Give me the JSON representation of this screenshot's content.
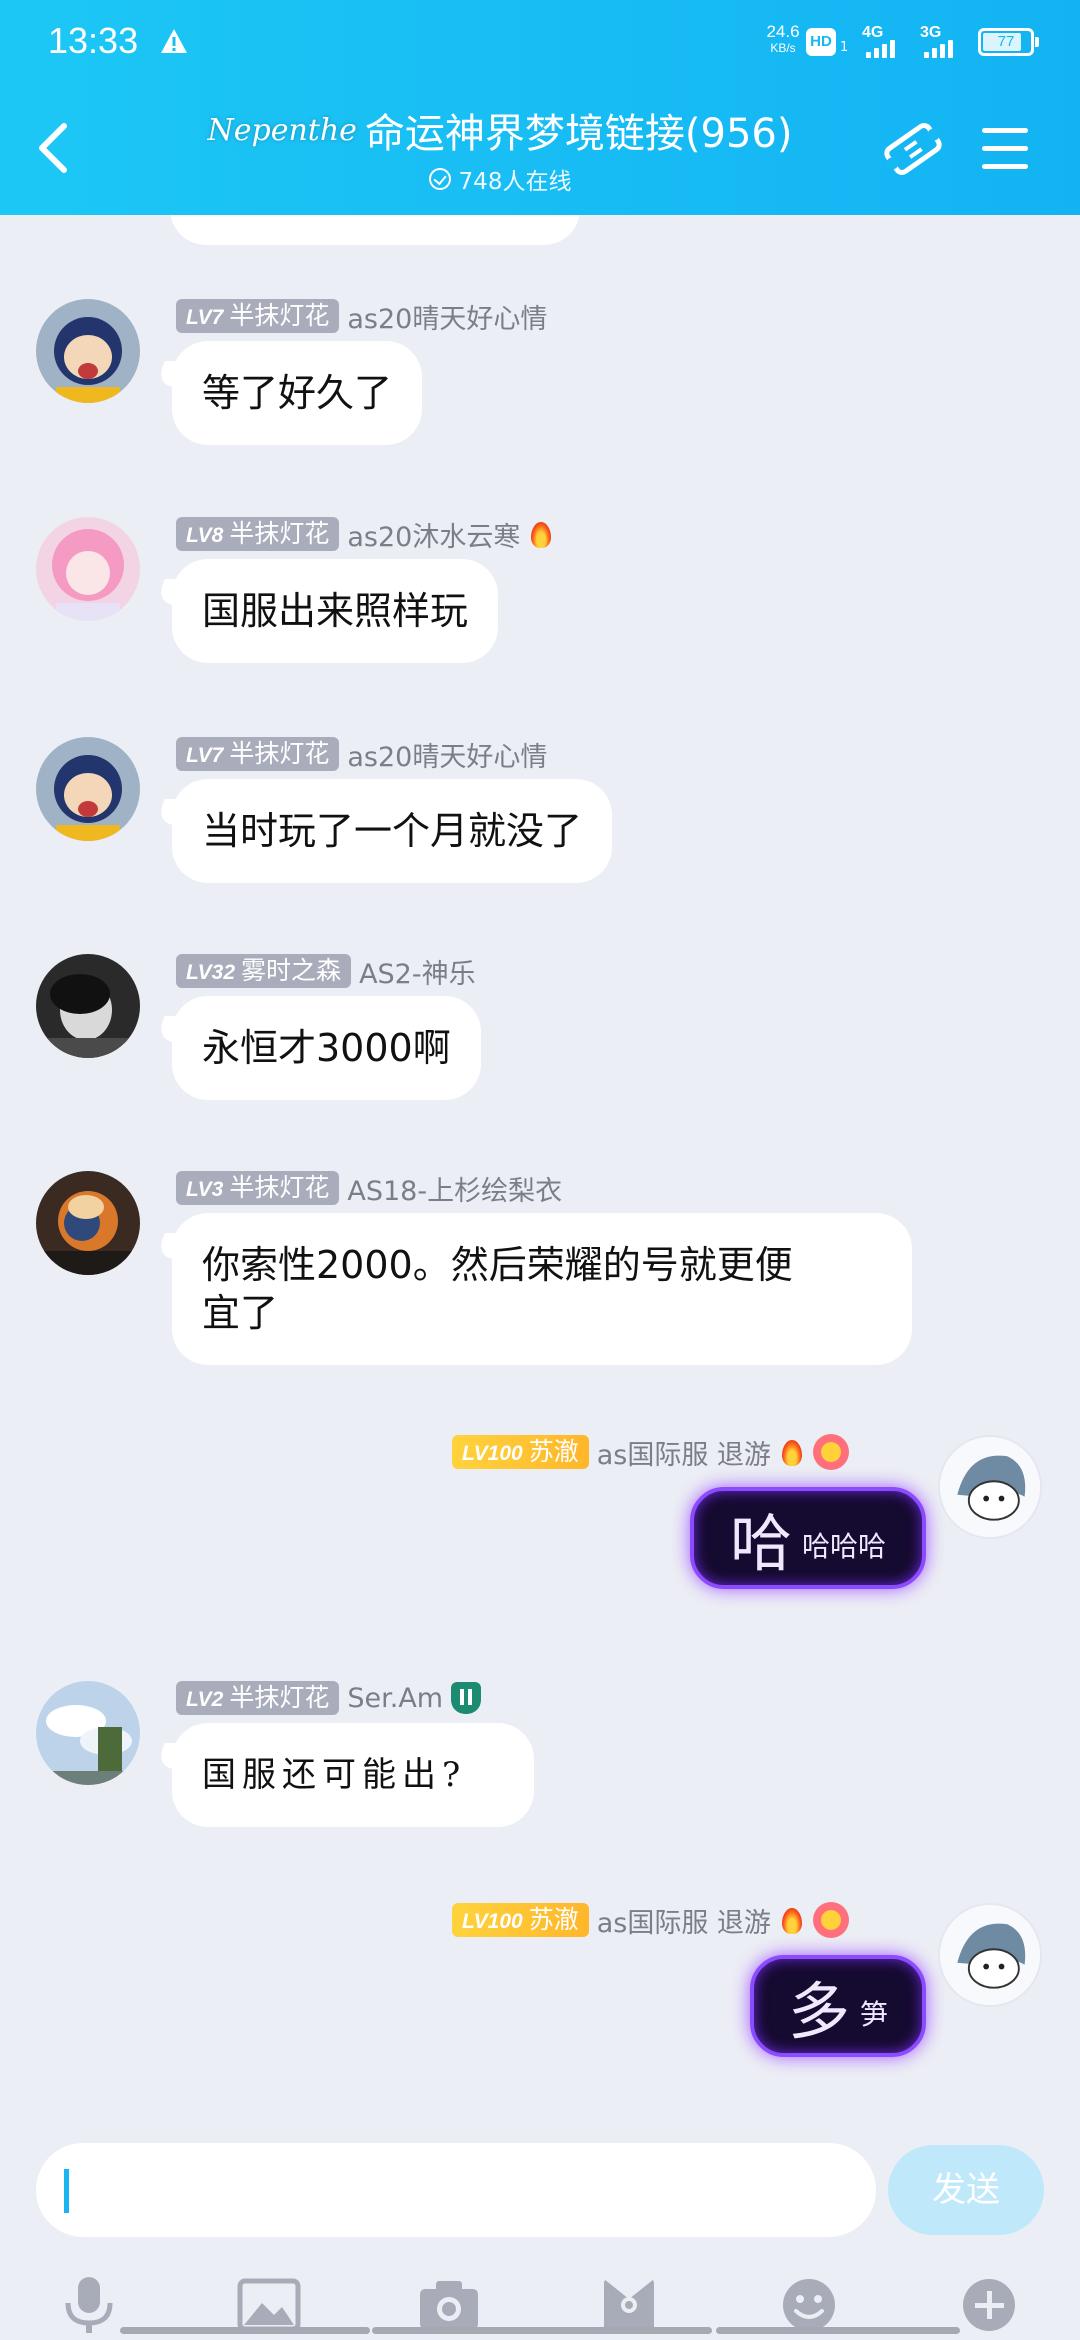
{
  "status_bar": {
    "time": "13:33",
    "net_speed_value": "24.6",
    "net_speed_unit": "KB/s",
    "hd": "HD",
    "sim1_sub": "1",
    "sig1": "4G",
    "sig2": "3G",
    "battery": "77"
  },
  "header": {
    "logo": "Nepenthe",
    "title": "命运神界梦境链接(956)",
    "online": "748人在线"
  },
  "messages": [
    {
      "level": "LV7",
      "title": "半抹灯花",
      "sender": "as20晴天好心情",
      "text": "等了好久了"
    },
    {
      "level": "LV8",
      "title": "半抹灯花",
      "sender": "as20沐水云寒",
      "text": "国服出来照样玩"
    },
    {
      "level": "LV7",
      "title": "半抹灯花",
      "sender": "as20晴天好心情",
      "text": "当时玩了一个月就没了"
    },
    {
      "level": "LV32",
      "title": "雾时之森",
      "sender": "AS2-神乐",
      "text": "永恒才3000啊"
    },
    {
      "level": "LV3",
      "title": "半抹灯花",
      "sender": "AS18-上杉绘梨衣",
      "text_line1": "你索性2000。然后荣耀的号就更便",
      "text_line2": "宜了"
    },
    {
      "level": "LV100",
      "title": "苏澈",
      "sender": "as国际服 退游",
      "sticker_big": "哈",
      "sticker_small": "哈哈哈"
    },
    {
      "level": "LV2",
      "title": "半抹灯花",
      "sender": "Ser.Am",
      "text": "国服还可能出?"
    },
    {
      "level": "LV100",
      "title": "苏澈",
      "sender": "as国际服 退游",
      "sticker_big": "多",
      "sticker_small": "笋"
    }
  ],
  "input": {
    "send": "发送"
  },
  "toolbar": [
    "mic-icon",
    "image-icon",
    "camera-icon",
    "gift-icon",
    "emoji-icon",
    "plus-icon"
  ],
  "colors": {
    "header": "#18bdf4",
    "background": "#eceef5",
    "level_badge": "#a8acbb",
    "level_badge_gold": "#ffc22f",
    "sticker_glow": "#8b4bff"
  }
}
